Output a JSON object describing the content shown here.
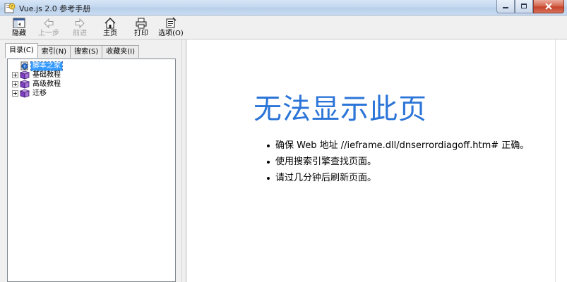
{
  "window": {
    "title": "Vue.js 2.0 参考手册",
    "minimize_icon": "minimize-icon",
    "maximize_icon": "maximize-icon",
    "close_icon": "close-icon"
  },
  "toolbar": {
    "items": [
      {
        "label": "隐藏",
        "icon": "hide-pane-icon",
        "enabled": true
      },
      {
        "label": "上一步",
        "icon": "back-arrow-icon",
        "enabled": false
      },
      {
        "label": "前进",
        "icon": "forward-arrow-icon",
        "enabled": false
      },
      {
        "label": "主页",
        "icon": "home-icon",
        "enabled": true
      },
      {
        "label": "打印",
        "icon": "print-icon",
        "enabled": true
      },
      {
        "label": "选项(O)",
        "icon": "options-icon",
        "enabled": true
      }
    ]
  },
  "nav": {
    "tabs": [
      {
        "label": "目录(C)",
        "active": true
      },
      {
        "label": "索引(N)",
        "active": false
      },
      {
        "label": "搜索(S)",
        "active": false
      },
      {
        "label": "收藏夹(I)",
        "active": false
      }
    ],
    "tree": [
      {
        "label": "脚本之家",
        "icon": "help-page-icon",
        "expandable": false,
        "selected": true
      },
      {
        "label": "基础教程",
        "icon": "book-icon",
        "expandable": true,
        "selected": false
      },
      {
        "label": "高级教程",
        "icon": "book-icon",
        "expandable": true,
        "selected": false
      },
      {
        "label": "迁移",
        "icon": "book-icon",
        "expandable": true,
        "selected": false
      }
    ]
  },
  "content": {
    "heading": "无法显示此页",
    "bullets": [
      "确保 Web 地址 //ieframe.dll/dnserrordiagoff.htm# 正确。",
      "使用搜索引擎查找页面。",
      "请过几分钟后刷新页面。"
    ]
  },
  "colors": {
    "heading": "#2b74d8",
    "selection": "#3399ff",
    "pane_bg": "#f0f0f0"
  }
}
